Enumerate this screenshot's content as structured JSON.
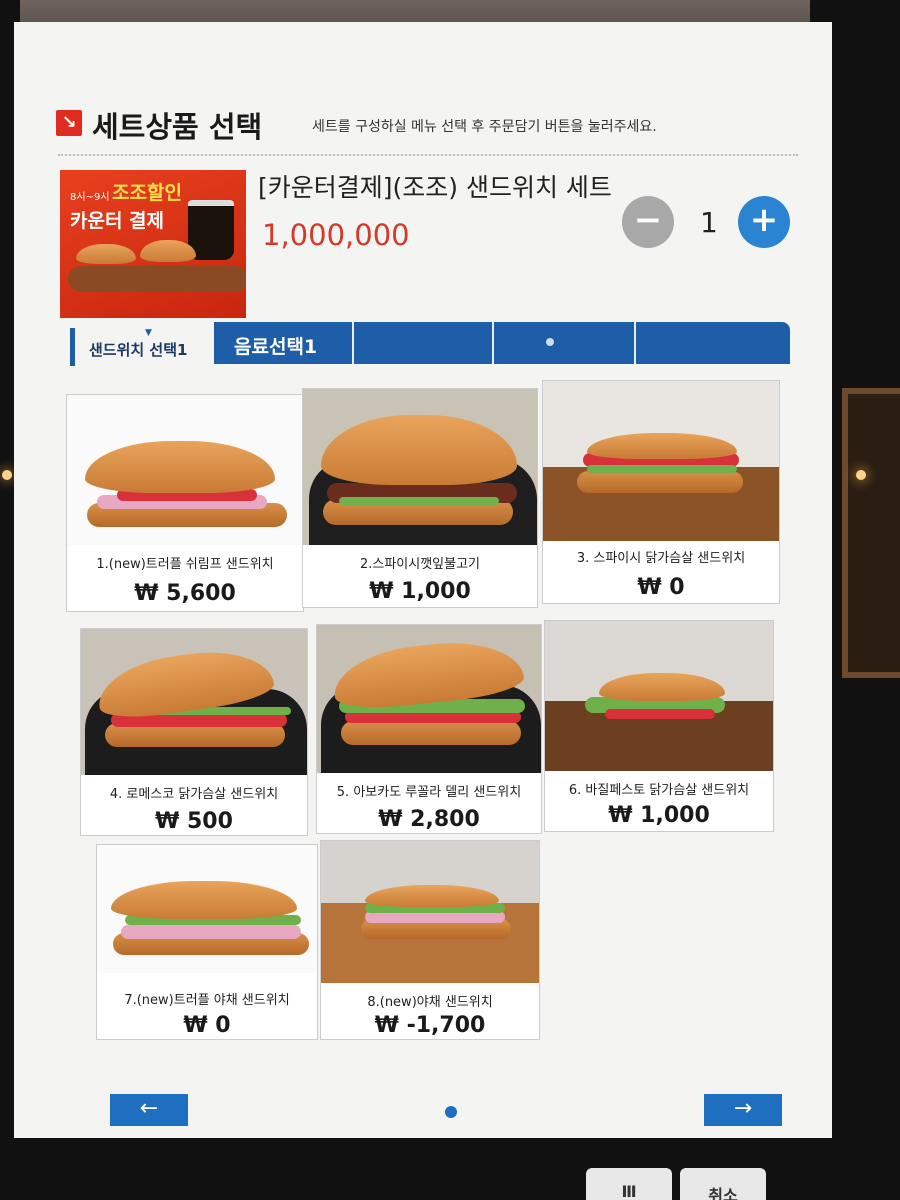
{
  "header": {
    "title": "세트상품 선택",
    "subtitle": "세트를 구성하실 메뉴 선택 후 주문담기 버튼을 눌러주세요."
  },
  "promo": {
    "time_text": "8시~9시",
    "line1": "조조할인",
    "line2": "카운터 결제"
  },
  "set": {
    "name": "[카운터결제](조조) 샌드위치 세트",
    "price": "1,000,000",
    "quantity": "1"
  },
  "tabs": {
    "first": "샌드위치 선택1",
    "active": "음료선택1"
  },
  "items": [
    {
      "name": "1.(new)트러플 쉬림프 샌드위치",
      "price": "₩ 5,600"
    },
    {
      "name": "2.스파이시깻잎불고기",
      "price": "₩ 1,000"
    },
    {
      "name": "3. 스파이시 닭가슴살 샌드위치",
      "price": "₩ 0"
    },
    {
      "name": "4. 로메스코 닭가슴살 샌드위치",
      "price": "₩ 500"
    },
    {
      "name": "5. 아보카도 루꼴라 델리 샌드위치",
      "price": "₩ 2,800"
    },
    {
      "name": "6. 바질페스토 닭가슴살 샌드위치",
      "price": "₩ 1,000"
    },
    {
      "name": "7.(new)트러플 야채 샌드위치",
      "price": "₩ 0"
    },
    {
      "name": "8.(new)야채 샌드위치",
      "price": "₩ -1,700"
    }
  ],
  "nav": {
    "prev": "←",
    "next": "→"
  },
  "bottom_keys": {
    "left": "Ⅲ",
    "right": "취소"
  },
  "colors": {
    "accent": "#1e5ea8",
    "price_red": "#d23a2a",
    "plus_blue": "#2a84d2",
    "minus_gray": "#a8a8a8"
  }
}
